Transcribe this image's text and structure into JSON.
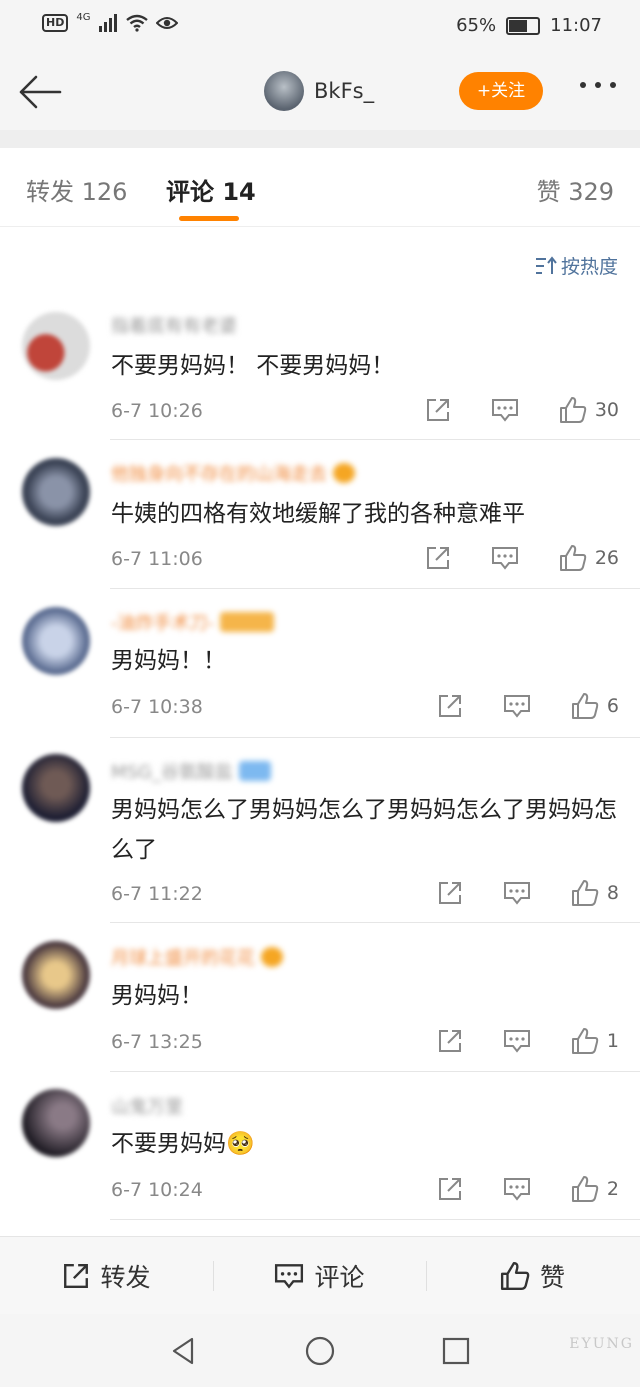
{
  "status_bar": {
    "network": "4G",
    "battery": "65%",
    "battery_level": 0.65,
    "time": "11:07"
  },
  "header": {
    "username": "BkFs_",
    "follow_label": "+关注"
  },
  "tabs": [
    {
      "label": "转发 126"
    },
    {
      "label": "评论 14"
    },
    {
      "label": "赞 329"
    }
  ],
  "sort_label": "按热度",
  "comments": [
    {
      "name": "指着底有有老婆",
      "text": "不要男妈妈！ 不要男妈妈！",
      "time": "6-7 10:26",
      "likes": "30"
    },
    {
      "name": "他独身向不存在的山海走去",
      "text": "牛姨的四格有效地缓解了我的各种意难平",
      "time": "6-7 11:06",
      "likes": "26"
    },
    {
      "name": "-油炸手术刀-",
      "text": "男妈妈！！",
      "time": "6-7 10:38",
      "likes": "6"
    },
    {
      "name": "MSG_谷氨酸盐",
      "text": "男妈妈怎么了男妈妈怎么了男妈妈怎么了男妈妈怎么了",
      "time": "6-7 11:22",
      "likes": "8"
    },
    {
      "name": "月球上盛开的花花",
      "text": "男妈妈！",
      "time": "6-7 13:25",
      "likes": "1"
    },
    {
      "name": "山鬼万里",
      "text": "不要男妈妈🥺",
      "time": "6-7 10:24",
      "likes": "2"
    }
  ],
  "bottom_bar": {
    "repost": "转发",
    "comment": "评论",
    "like": "赞"
  },
  "watermark": "EYUNG"
}
